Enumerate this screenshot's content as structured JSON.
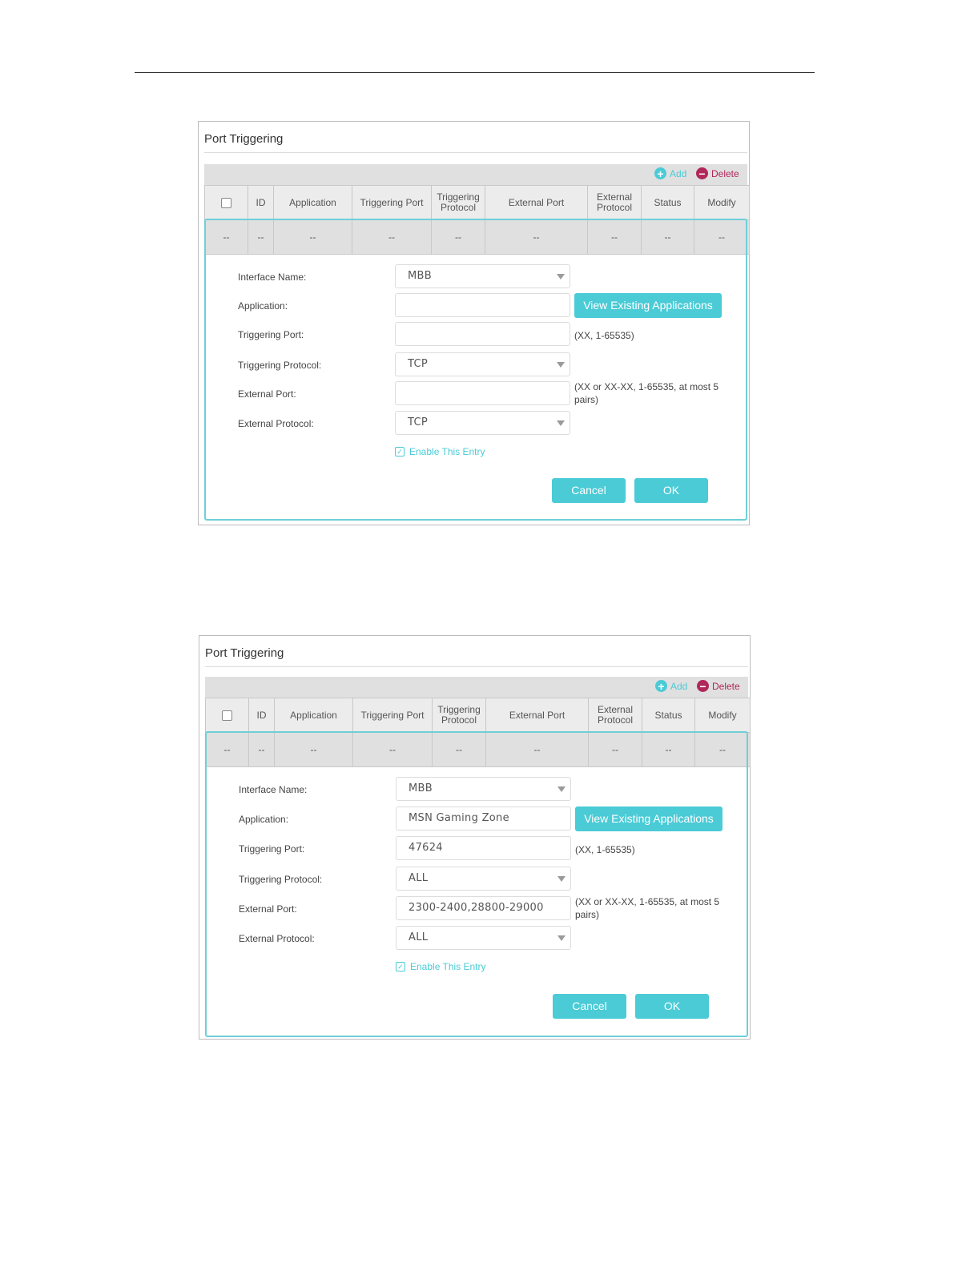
{
  "panels": [
    {
      "title": "Port Triggering",
      "toolbar": {
        "add": "Add",
        "delete": "Delete"
      },
      "columns": [
        "ID",
        "Application",
        "Triggering Port",
        "Triggering Protocol",
        "External Port",
        "External Protocol",
        "Status",
        "Modify"
      ],
      "row": [
        "--",
        "--",
        "--",
        "--",
        "--",
        "--",
        "--",
        "--",
        "--"
      ],
      "form": {
        "interface_label": "Interface Name:",
        "interface_value": "MBB",
        "application_label": "Application:",
        "application_value": "",
        "view_button": "View Existing Applications",
        "trig_port_label": "Triggering Port:",
        "trig_port_value": "",
        "trig_port_hint": "(XX, 1-65535)",
        "trig_proto_label": "Triggering Protocol:",
        "trig_proto_value": "TCP",
        "ext_port_label": "External Port:",
        "ext_port_value": "",
        "ext_port_hint": "(XX or XX-XX, 1-65535, at most 5 pairs)",
        "ext_proto_label": "External Protocol:",
        "ext_proto_value": "TCP",
        "enable_label": "Enable This Entry",
        "cancel": "Cancel",
        "ok": "OK"
      }
    },
    {
      "title": "Port Triggering",
      "toolbar": {
        "add": "Add",
        "delete": "Delete"
      },
      "columns": [
        "ID",
        "Application",
        "Triggering Port",
        "Triggering Protocol",
        "External Port",
        "External Protocol",
        "Status",
        "Modify"
      ],
      "row": [
        "--",
        "--",
        "--",
        "--",
        "--",
        "--",
        "--",
        "--",
        "--"
      ],
      "form": {
        "interface_label": "Interface Name:",
        "interface_value": "MBB",
        "application_label": "Application:",
        "application_value": "MSN Gaming Zone",
        "view_button": "View Existing Applications",
        "trig_port_label": "Triggering Port:",
        "trig_port_value": "47624",
        "trig_port_hint": "(XX, 1-65535)",
        "trig_proto_label": "Triggering Protocol:",
        "trig_proto_value": "ALL",
        "ext_port_label": "External Port:",
        "ext_port_value": "2300-2400,28800-29000",
        "ext_port_hint": "(XX or XX-XX, 1-65535, at most 5 pairs)",
        "ext_proto_label": "External Protocol:",
        "ext_proto_value": "ALL",
        "enable_label": "Enable This Entry",
        "cancel": "Cancel",
        "ok": "OK"
      }
    }
  ],
  "colors": {
    "accent": "#4acbd6",
    "delete": "#b0275a",
    "toolbar": "#e0e0e0"
  },
  "icons": {
    "add": "plus-circle-icon",
    "delete": "minus-circle-icon",
    "dropdown": "caret-down-icon",
    "check": "checkbox-checked-icon"
  }
}
